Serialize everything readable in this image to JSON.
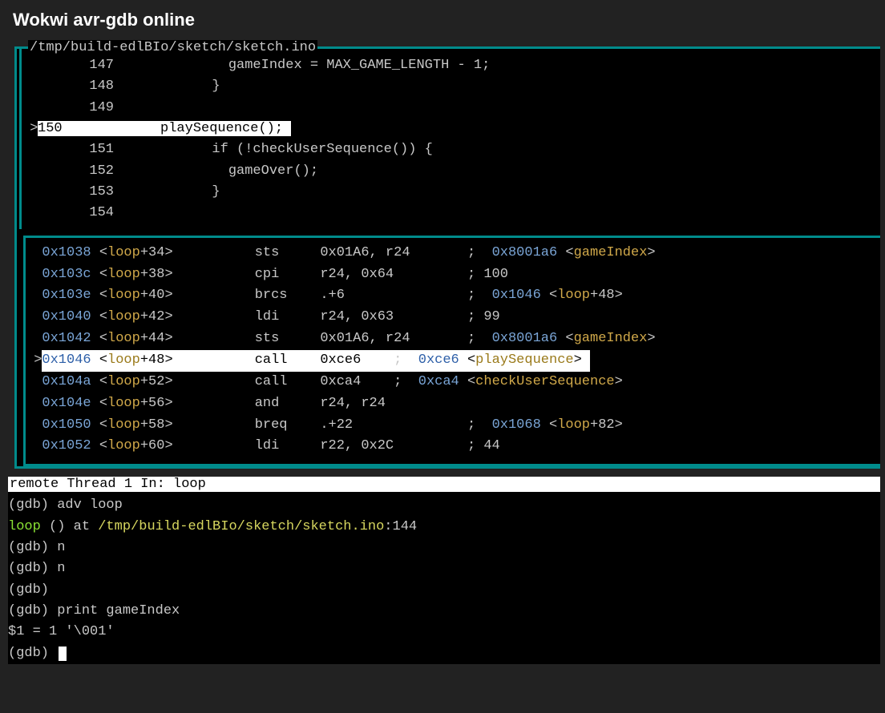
{
  "title": "Wokwi avr-gdb online",
  "sourceFile": "/tmp/build-edlBIo/sketch/sketch.ino",
  "sourceLines": [
    {
      "num": "147",
      "curr": false,
      "hl": false,
      "text": "            gameIndex = MAX_GAME_LENGTH - 1;"
    },
    {
      "num": "148",
      "curr": false,
      "hl": false,
      "text": "          }"
    },
    {
      "num": "149",
      "curr": false,
      "hl": false,
      "text": ""
    },
    {
      "num": "150",
      "curr": true,
      "hl": true,
      "text": "          playSequence();"
    },
    {
      "num": "151",
      "curr": false,
      "hl": false,
      "text": "          if (!checkUserSequence()) {"
    },
    {
      "num": "152",
      "curr": false,
      "hl": false,
      "text": "            gameOver();"
    },
    {
      "num": "153",
      "curr": false,
      "hl": false,
      "text": "          }"
    },
    {
      "num": "154",
      "curr": false,
      "hl": false,
      "text": ""
    }
  ],
  "asmLines": [
    {
      "curr": false,
      "addr": "0x1038",
      "sym": "loop",
      "off": "34",
      "opc": "sts",
      "args": "0x01A6, r24",
      "caddr": "0x8001a6",
      "csym": "gameIndex",
      "coff": ""
    },
    {
      "curr": false,
      "addr": "0x103c",
      "sym": "loop",
      "off": "38",
      "opc": "cpi",
      "args": "r24, 0x64",
      "clit": "100"
    },
    {
      "curr": false,
      "addr": "0x103e",
      "sym": "loop",
      "off": "40",
      "opc": "brcs",
      "args": ".+6",
      "caddr": "0x1046",
      "csym": "loop",
      "coff": "48"
    },
    {
      "curr": false,
      "addr": "0x1040",
      "sym": "loop",
      "off": "42",
      "opc": "ldi",
      "args": "r24, 0x63",
      "clit": "99"
    },
    {
      "curr": false,
      "addr": "0x1042",
      "sym": "loop",
      "off": "44",
      "opc": "sts",
      "args": "0x01A6, r24",
      "caddr": "0x8001a6",
      "csym": "gameIndex",
      "coff": ""
    },
    {
      "curr": true,
      "addr": "0x1046",
      "sym": "loop",
      "off": "48",
      "opc": "call",
      "args": "0xce6",
      "inline": true,
      "caddr": "0xce6",
      "csym": "playSequence",
      "coff": ""
    },
    {
      "curr": false,
      "addr": "0x104a",
      "sym": "loop",
      "off": "52",
      "opc": "call",
      "args": "0xca4",
      "inline": true,
      "caddr": "0xca4",
      "csym": "checkUserSequence",
      "coff": ""
    },
    {
      "curr": false,
      "addr": "0x104e",
      "sym": "loop",
      "off": "56",
      "opc": "and",
      "args": "r24, r24"
    },
    {
      "curr": false,
      "addr": "0x1050",
      "sym": "loop",
      "off": "58",
      "opc": "breq",
      "args": ".+22",
      "caddr": "0x1068",
      "csym": "loop",
      "coff": "82"
    },
    {
      "curr": false,
      "addr": "0x1052",
      "sym": "loop",
      "off": "60",
      "opc": "ldi",
      "args": "r22, 0x2C",
      "clit": "44"
    }
  ],
  "status": "remote Thread 1 In: loop",
  "console": [
    {
      "type": "cmd",
      "prompt": "(gdb) ",
      "text": "adv loop"
    },
    {
      "type": "out",
      "segments": [
        {
          "class": "grn",
          "text": "loop"
        },
        {
          "class": "",
          "text": " () at "
        },
        {
          "class": "yel",
          "text": "/tmp/build-edlBIo/sketch/sketch.ino"
        },
        {
          "class": "",
          "text": ":144"
        }
      ]
    },
    {
      "type": "cmd",
      "prompt": "(gdb) ",
      "text": "n"
    },
    {
      "type": "cmd",
      "prompt": "(gdb) ",
      "text": "n"
    },
    {
      "type": "cmd",
      "prompt": "(gdb) ",
      "text": ""
    },
    {
      "type": "cmd",
      "prompt": "(gdb) ",
      "text": "print gameIndex"
    },
    {
      "type": "out",
      "segments": [
        {
          "class": "",
          "text": "$1 = 1 '\\001'"
        }
      ]
    },
    {
      "type": "cmd",
      "prompt": "(gdb) ",
      "text": "",
      "cursor": true
    }
  ]
}
